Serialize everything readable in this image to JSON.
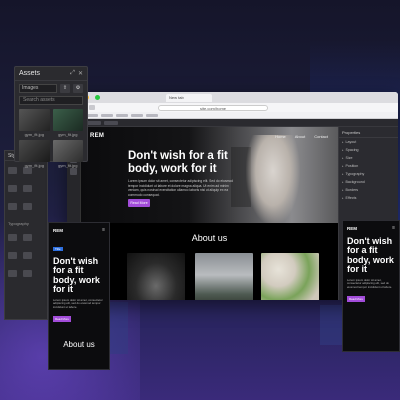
{
  "assets_panel": {
    "title": "Assets",
    "filter_value": "Images",
    "search_placeholder": "Search assets",
    "items": [
      {
        "caption": "gym_fit.jpg"
      },
      {
        "caption": "gym_fit.jpg"
      },
      {
        "caption": "gym_fit.jpg"
      },
      {
        "caption": "gym_fit.jpg"
      }
    ]
  },
  "tools_panel": {
    "title": "Style",
    "section": "Typography"
  },
  "browser": {
    "tab_label": "New tab",
    "url": "site.com/home"
  },
  "page": {
    "logo": "REM",
    "nav_links": [
      "Home",
      "About",
      "Contact"
    ],
    "hero_title": "Don't wish for a fit body, work for it",
    "hero_text": "Lorem ipsum dolor sit amet, consectetur adipiscing elit. Sed do eiusmod tempor incididunt ut labore et dolore magna aliqua. Ut enim ad minim veniam, quis nostrud exercitation ullamco laboris nisi ut aliquip ex ea commodo consequat.",
    "hero_button": "Read More",
    "about_title": "About us"
  },
  "right_panel": {
    "title": "Properties",
    "items": [
      "Layout",
      "Spacing",
      "Size",
      "Position",
      "Typography",
      "Background",
      "Borders",
      "Effects"
    ]
  },
  "mobile_left": {
    "logo": "REM",
    "tag": "Title",
    "title": "Don't wish for a fit body, work for it",
    "text": "Lorem ipsum dolor sit amet, consectetur adipiscing elit, sed do eiusmod tempor incididunt ut labore.",
    "button": "Read More",
    "about": "About us"
  },
  "mobile_right": {
    "logo": "REM",
    "title": "Don't wish for a fit body, work for it",
    "text": "Lorem ipsum dolor sit amet, consectetur adipiscing elit, sed do eiusmod tempor incididunt ut labore.",
    "button": "Read More"
  },
  "colors": {
    "accent": "#a24cd9",
    "tag_blue": "#2d6fe0"
  }
}
